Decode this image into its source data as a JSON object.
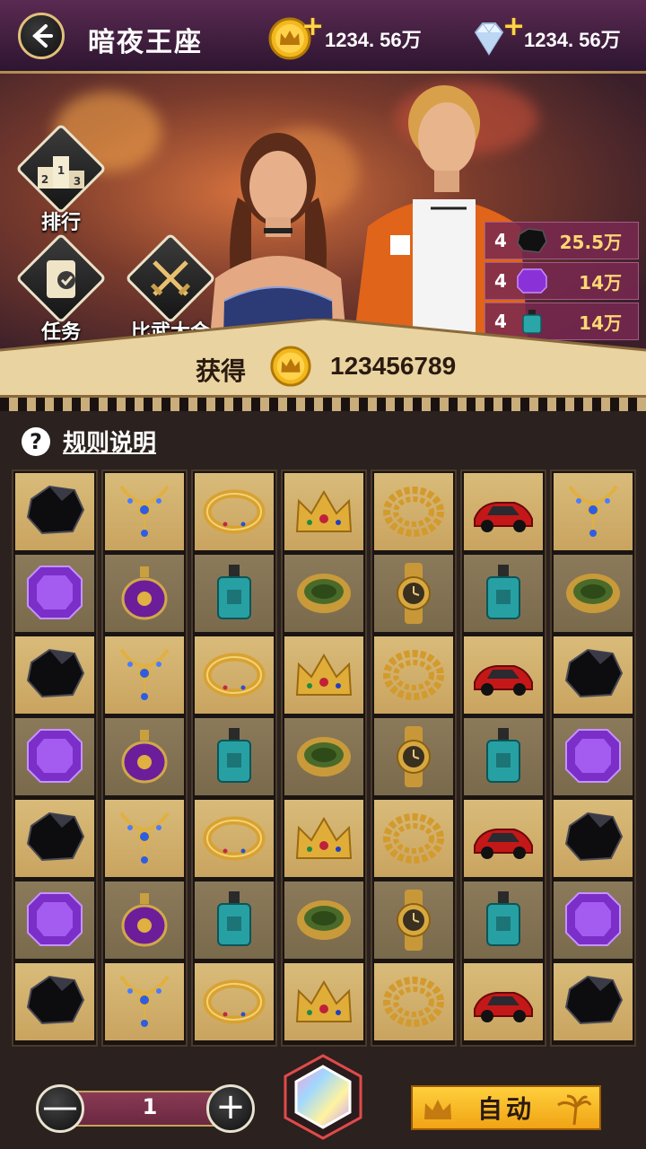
{
  "header": {
    "title": "暗夜王座",
    "gold_amount": "1234. 56万",
    "diamond_amount": "1234. 56万"
  },
  "side_buttons": {
    "rank": "排行",
    "task": "任务",
    "tournament": "比武大会"
  },
  "rewards": [
    {
      "count": "4",
      "icon": "black-gem-icon",
      "value": "25.5万"
    },
    {
      "count": "4",
      "icon": "purple-gem-icon",
      "value": "14万"
    },
    {
      "count": "4",
      "icon": "perfume-icon",
      "value": "14万"
    }
  ],
  "obtain": {
    "label": "获得",
    "amount": "123456789"
  },
  "rules": {
    "label": "规则说明"
  },
  "grid": [
    [
      "black-gem",
      "purple-gem",
      "black-gem",
      "purple-gem",
      "black-gem",
      "purple-gem",
      "black-gem"
    ],
    [
      "necklace",
      "perfume-bottle",
      "necklace",
      "perfume-bottle",
      "necklace",
      "perfume-bottle",
      "necklace"
    ],
    [
      "gold-ring",
      "perfume",
      "gold-ring",
      "perfume",
      "gold-ring",
      "perfume",
      "gold-ring"
    ],
    [
      "crown",
      "jade-ring",
      "crown",
      "jade-ring",
      "crown",
      "jade-ring",
      "crown"
    ],
    [
      "gold-chain",
      "gold-watch",
      "gold-chain",
      "gold-watch",
      "gold-chain",
      "gold-watch",
      "gold-chain"
    ],
    [
      "sports-car",
      "perfume",
      "sports-car",
      "perfume",
      "sports-car",
      "perfume",
      "sports-car"
    ],
    [
      "necklace",
      "jade-ring",
      "black-gem",
      "purple-gem",
      "black-gem",
      "purple-gem",
      "black-gem"
    ]
  ],
  "controls": {
    "quantity": "1",
    "minus": "—",
    "plus": "+",
    "auto_label": "自动"
  },
  "colors": {
    "gold": "#e2c07a",
    "banner": "#e9d3a0",
    "header": "#4a2244"
  }
}
